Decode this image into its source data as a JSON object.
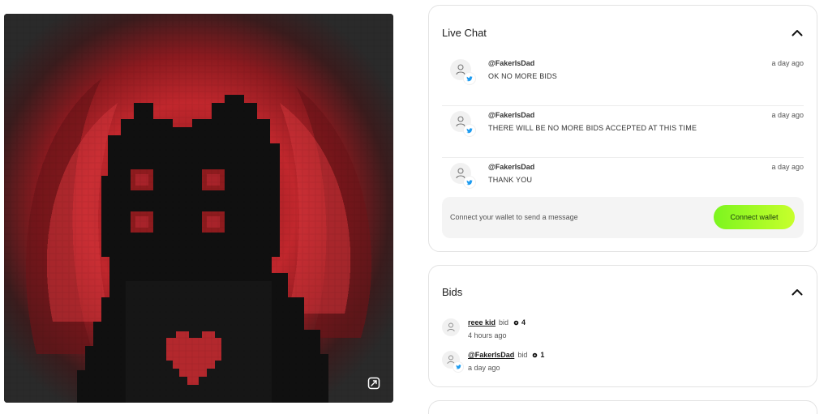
{
  "live_chat": {
    "title": "Live Chat",
    "messages": [
      {
        "user": "@FakerIsDad",
        "time": "a day ago",
        "text": "OK NO MORE BIDS",
        "avatar_icon": "user-icon",
        "badge_icon": "twitter-icon"
      },
      {
        "user": "@FakerIsDad",
        "time": "a day ago",
        "text": "THERE WILL BE NO MORE BIDS ACCEPTED AT THIS TIME",
        "avatar_icon": "user-icon",
        "badge_icon": "twitter-icon"
      },
      {
        "user": "@FakerIsDad",
        "time": "a day ago",
        "text": "THANK YOU",
        "avatar_icon": "user-icon",
        "badge_icon": "twitter-icon"
      }
    ],
    "compose_hint": "Connect your wallet to send a message",
    "connect_label": "Connect wallet"
  },
  "bids": {
    "title": "Bids",
    "items": [
      {
        "user": "reee kid",
        "action": "bid",
        "amount": "4",
        "time": "4 hours ago",
        "has_twitter": false
      },
      {
        "user": "@FakerIsDad",
        "action": "bid",
        "amount": "1",
        "time": "a day ago",
        "has_twitter": true
      }
    ]
  },
  "colors": {
    "accent_start": "#7cf51f",
    "accent_end": "#c8ff2c",
    "twitter": "#1d9bf0",
    "art_red": "#b3242a",
    "art_dark": "#111111"
  },
  "icons": {
    "expand": "expand-icon",
    "collapse": "chevron-up-icon",
    "currency": "currency-icon"
  }
}
